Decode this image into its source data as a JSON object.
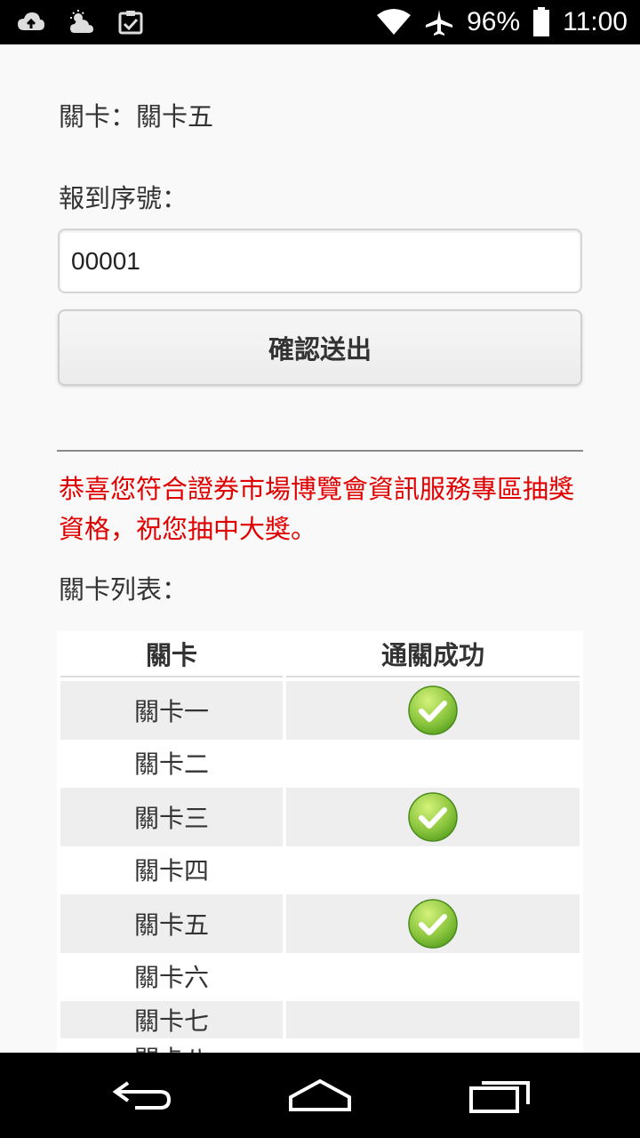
{
  "status_bar": {
    "battery": "96%",
    "time": "11:00",
    "icons_left": [
      "cloud-upload-icon",
      "weather-icon",
      "clipboard-check-icon"
    ],
    "icons_right": [
      "wifi-icon",
      "airplane-icon",
      "battery-icon"
    ]
  },
  "form": {
    "stage_line": "關卡：關卡五",
    "serial_label": "報到序號：",
    "serial_value": "00001",
    "submit_label": "確認送出"
  },
  "message": {
    "text": "恭喜您符合證券市場博覽會資訊服務專區抽獎資格，祝您抽中大獎。",
    "color": "#e00000"
  },
  "stage_list": {
    "label": "關卡列表：",
    "headers": {
      "stage": "關卡",
      "passed": "通關成功"
    },
    "rows": [
      {
        "name": "關卡一",
        "passed": true
      },
      {
        "name": "關卡二",
        "passed": false
      },
      {
        "name": "關卡三",
        "passed": true
      },
      {
        "name": "關卡四",
        "passed": false
      },
      {
        "name": "關卡五",
        "passed": true
      },
      {
        "name": "關卡六",
        "passed": false
      },
      {
        "name": "關卡七",
        "passed": false
      },
      {
        "name": "關卡八",
        "passed": false
      }
    ]
  },
  "nav_bar": {
    "buttons": [
      "back-icon",
      "home-icon",
      "recents-icon"
    ]
  }
}
